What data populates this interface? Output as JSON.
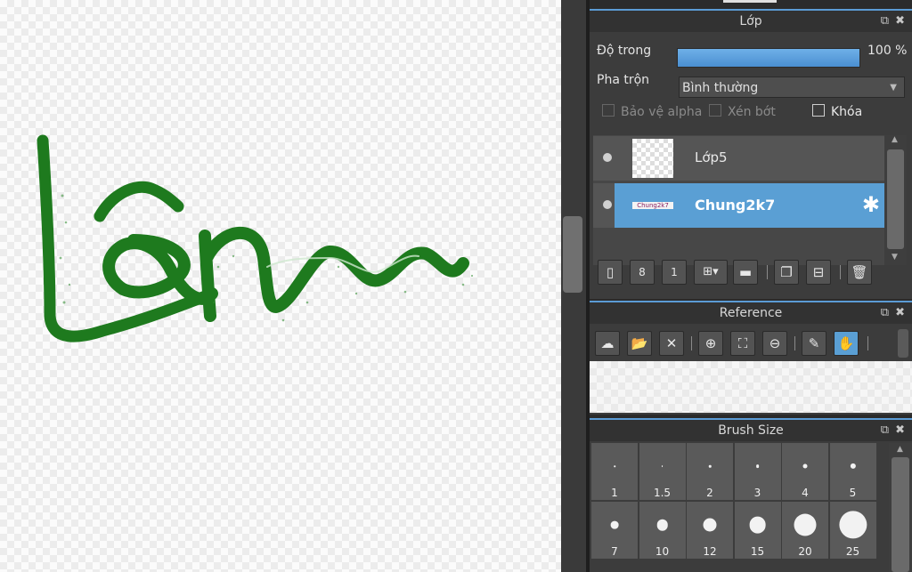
{
  "canvas": {
    "stroke_color": "#1e7a1e"
  },
  "layer_panel": {
    "title": "Lớp",
    "popout_icon": "popout-icon",
    "close_icon": "close-icon",
    "opacity_label": "Độ trong",
    "opacity_value": "100 %",
    "opacity_fraction": 1.0,
    "blend_label": "Pha trộn",
    "blend_value": "Bình thường",
    "protect_alpha": "Bảo vệ alpha",
    "clipping": "Xén bớt",
    "lock": "Khóa",
    "layers": [
      {
        "name": "Lớp5",
        "selected": false
      },
      {
        "name": "Chung2k7",
        "thumb_text": "Chung2k7",
        "selected": true
      }
    ],
    "toolbar_icons": [
      "new-layer-icon",
      "new-8bit-layer-icon",
      "new-1bit-layer-icon",
      "add-layer-dropdown-icon",
      "new-folder-icon",
      "duplicate-layer-icon",
      "merge-layer-icon",
      "delete-layer-icon"
    ]
  },
  "reference_panel": {
    "title": "Reference",
    "toolbar_icons": [
      "cloud-open-icon",
      "folder-open-icon",
      "close-icon",
      "zoom-in-icon",
      "fit-icon",
      "zoom-out-icon",
      "eyedropper-icon",
      "hand-icon"
    ]
  },
  "brush_panel": {
    "title": "Brush Size",
    "sizes": [
      "1",
      "1.5",
      "2",
      "3",
      "4",
      "5",
      "7",
      "10",
      "12",
      "15",
      "20",
      "25"
    ]
  },
  "colors": {
    "accent": "#5b9bd5",
    "selected_layer": "#5a9fd4",
    "panel": "#3c3c3c"
  }
}
